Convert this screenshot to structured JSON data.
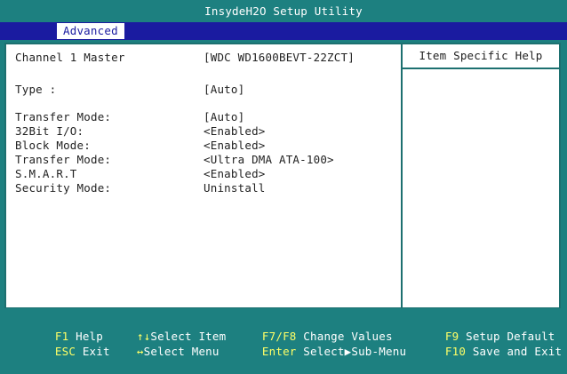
{
  "app": {
    "title": "InsydeH2O Setup Utility"
  },
  "menu": {
    "active_tab": "Advanced"
  },
  "help": {
    "title": "Item Specific Help"
  },
  "settings": [
    {
      "label": "Channel 1 Master",
      "value": "[WDC WD1600BEVT-22ZCT]"
    },
    {
      "label": "Type :",
      "value": "[Auto]"
    },
    {
      "label": "Transfer Mode:",
      "value": "[Auto]"
    },
    {
      "label": "32Bit I/O:",
      "value": "<Enabled>"
    },
    {
      "label": "Block Mode:",
      "value": "<Enabled>"
    },
    {
      "label": "Transfer Mode:",
      "value": "<Ultra DMA ATA-100>"
    },
    {
      "label": "S.M.A.R.T",
      "value": "<Enabled>"
    },
    {
      "label": "Security Mode:",
      "value": "Uninstall"
    }
  ],
  "footer": {
    "row1": [
      {
        "key": "F1",
        "text": "Help"
      },
      {
        "key": "↑↓",
        "text": "Select Item"
      },
      {
        "key": "F7/F8",
        "text": "Change Values"
      },
      {
        "key": "F9",
        "text": "Setup Default"
      }
    ],
    "row2": [
      {
        "key": "ESC",
        "text": "Exit"
      },
      {
        "key": "↔",
        "text": "Select Menu"
      },
      {
        "key": "Enter",
        "text": "Select▶Sub-Menu"
      },
      {
        "key": "F10",
        "text": "Save and Exit"
      }
    ]
  },
  "colors": {
    "frame_teal": "#1d8080",
    "menu_blue": "#1a1ba0",
    "panel_white": "#ffffff",
    "text_dark": "#222222",
    "hotkey_yellow": "#ffff66"
  }
}
